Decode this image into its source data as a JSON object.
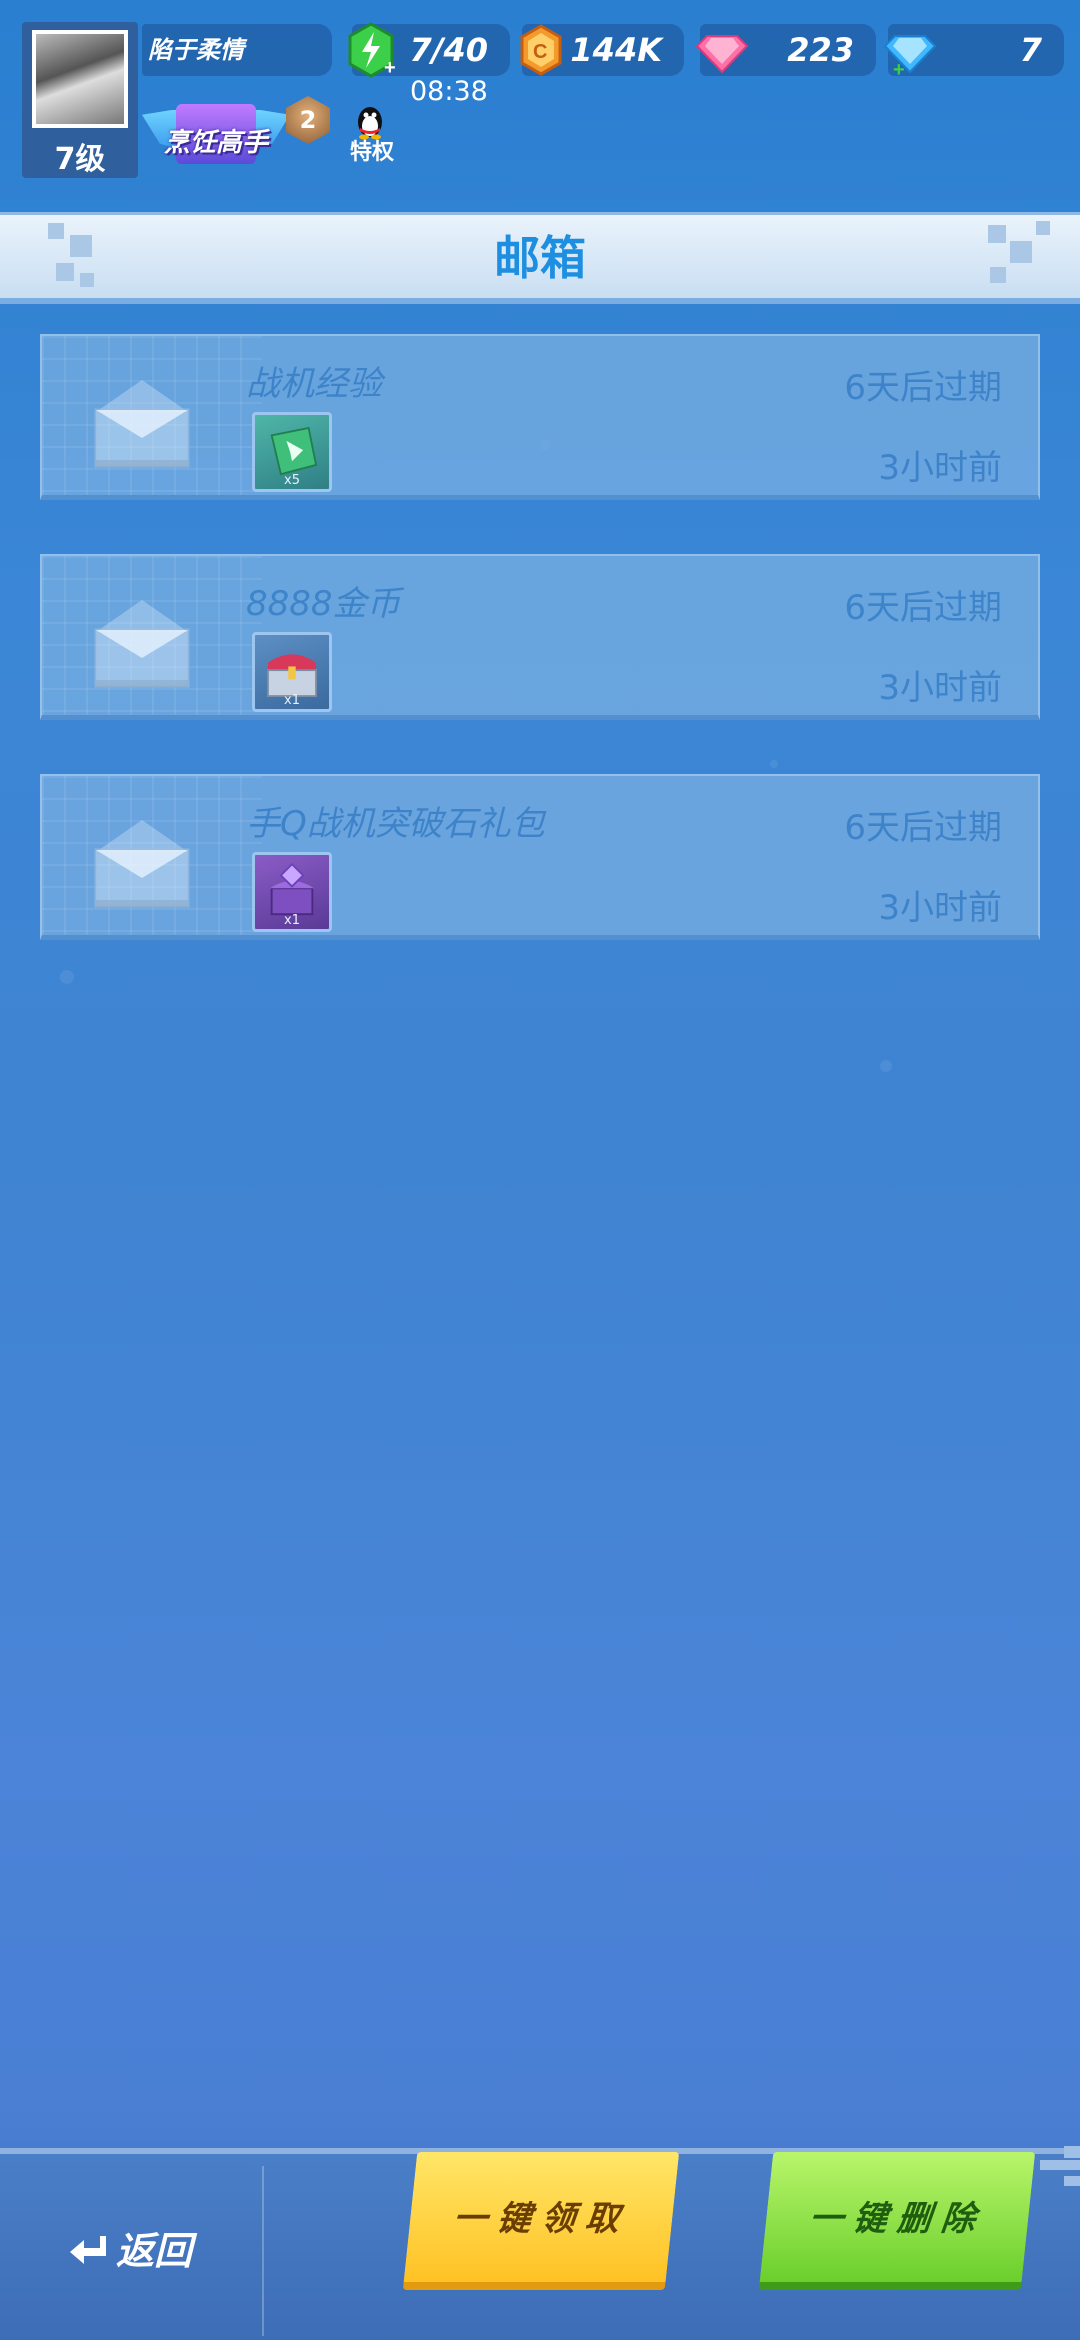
{
  "profile": {
    "nickname": "陷于柔情",
    "level_label": "7级",
    "title_text": "烹饪高手",
    "rank_number": "2",
    "privilege_label": "特权"
  },
  "resources": {
    "stamina": "7/40",
    "coins": "144K",
    "pink_gems": "223",
    "diamonds": "7"
  },
  "clock": "08:38",
  "mailbox": {
    "title": "邮箱",
    "items": [
      {
        "title": "战机经验",
        "expire": "6天后过期",
        "time": "3小时前",
        "attachment_qty": "x5",
        "attachment_icon": "fighter-exp-icon"
      },
      {
        "title": "8888金币",
        "expire": "6天后过期",
        "time": "3小时前",
        "attachment_qty": "x1",
        "attachment_icon": "coin-chest-icon"
      },
      {
        "title": "手Q战机突破石礼包",
        "expire": "6天后过期",
        "time": "3小时前",
        "attachment_qty": "x1",
        "attachment_icon": "breakthrough-stone-gift-icon"
      }
    ]
  },
  "bottom": {
    "back_label": "返回",
    "claim_all_label": "一键领取",
    "delete_all_label": "一键删除"
  },
  "colors": {
    "accent_blue": "#1e8ee0",
    "claim_yellow": "#ffc224",
    "delete_green": "#6bcf2c"
  }
}
